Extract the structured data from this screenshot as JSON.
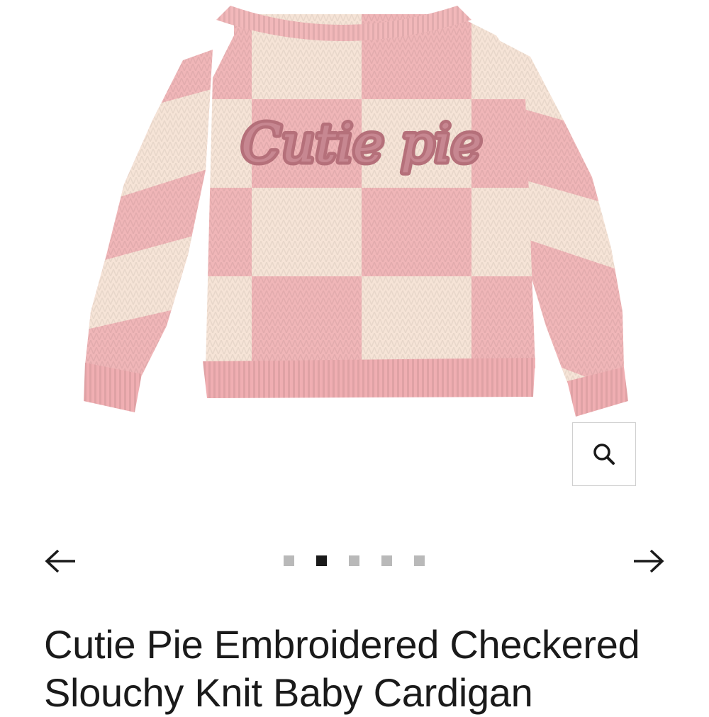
{
  "image": {
    "alt": "Pink and cream checkered knit baby cardigan, back view",
    "embroidery_text": "Cutie pie"
  },
  "controls": {
    "zoom_icon": "search-icon",
    "prev_icon": "arrow-left-icon",
    "next_icon": "arrow-right-icon"
  },
  "carousel": {
    "slide_count": 5,
    "active_index": 1
  },
  "product": {
    "title": "Cutie Pie Embroidered Checkered Slouchy Knit Baby Cardigan"
  },
  "colors": {
    "pink": "#f0b6b8",
    "cream": "#f6e4d7",
    "embroidery": "#b5707a",
    "dot_active": "#1a1a1a",
    "dot_inactive": "#b9b9b9"
  }
}
